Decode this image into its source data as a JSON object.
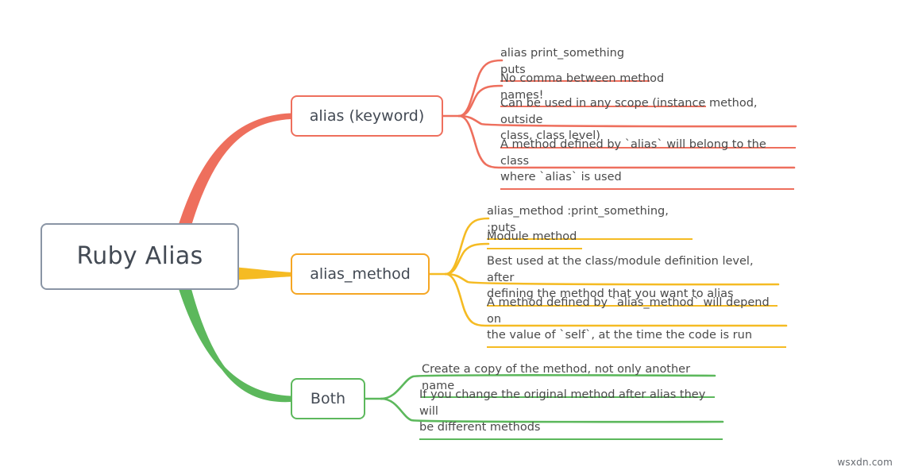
{
  "diagram": {
    "type": "mind-map",
    "watermark": "wsxdn.com",
    "root": {
      "label": "Ruby Alias",
      "border_color": "#8a95a5",
      "text_color": "#434a54"
    },
    "branches": [
      {
        "id": "alias-keyword",
        "label": "alias (keyword)",
        "color": "#ee6f5d",
        "leaves": [
          {
            "text": "alias print_something puts"
          },
          {
            "text": "No comma between method names!"
          },
          {
            "text": "Can be used in any scope (instance method, outside\nclass, class level)"
          },
          {
            "text": "A method defined by `alias` will belong to the class\nwhere `alias` is used"
          }
        ]
      },
      {
        "id": "alias-method",
        "label": "alias_method",
        "color": "#f5bb23",
        "leaves": [
          {
            "text": "alias_method :print_something, :puts"
          },
          {
            "text": "Module method"
          },
          {
            "text": "Best used at the class/module definition level, after\ndefining the method that you want to alias"
          },
          {
            "text": "A method defined by `alias_method` will depend on\nthe value of `self`, at the time the code is run"
          }
        ]
      },
      {
        "id": "both",
        "label": "Both",
        "color": "#5cb85c",
        "leaves": [
          {
            "text": "Create a copy of the method, not only another name"
          },
          {
            "text": "If you change the original method after alias they will\nbe different methods"
          }
        ]
      }
    ]
  }
}
